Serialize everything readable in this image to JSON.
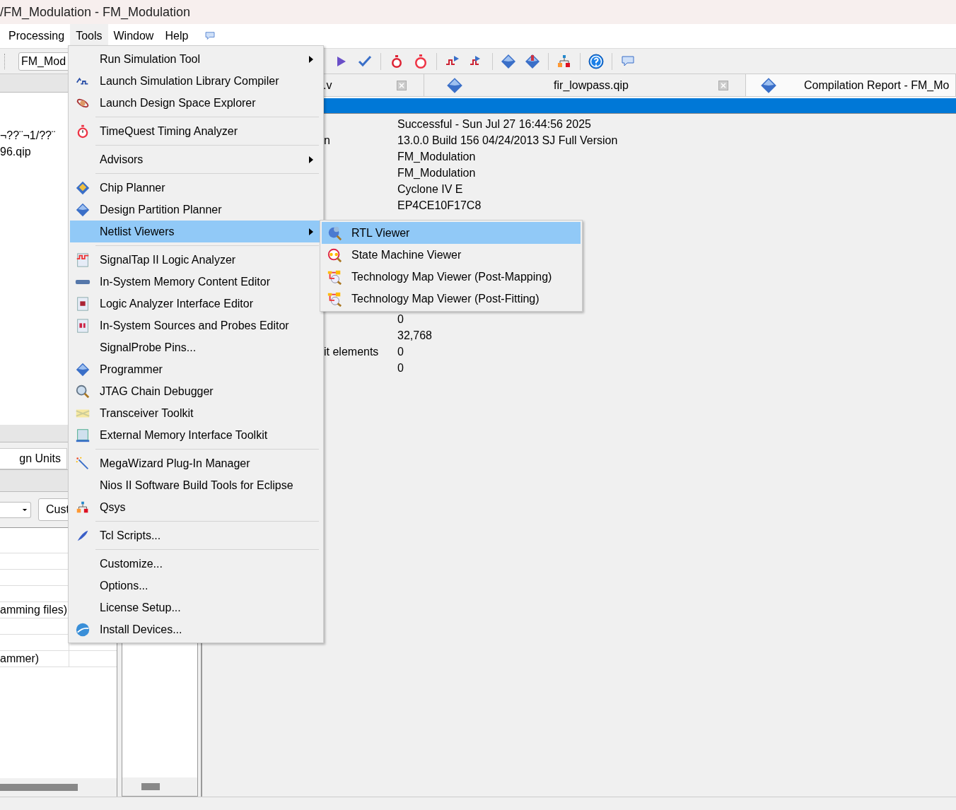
{
  "window": {
    "title": "/FM_Modulation - FM_Modulation"
  },
  "menu_bar": [
    {
      "label": "Processing",
      "selected": false
    },
    {
      "label": "Tools",
      "selected": true
    },
    {
      "label": "Window",
      "selected": false
    },
    {
      "label": "Help",
      "selected": false
    }
  ],
  "toolbar": {
    "project_combo": "FM_Mod"
  },
  "project_navigator": {
    "lines": [
      "¬??¨¬1/??¨",
      "96.qip"
    ]
  },
  "tasks": {
    "tab": "gn Units",
    "button": "Cust",
    "rows": [
      {},
      {},
      {},
      {},
      {
        "label": "amming files)"
      },
      {},
      {},
      {
        "label": "ammer)"
      }
    ]
  },
  "editor_tabs": [
    {
      "label": ".v",
      "selected": false
    },
    {
      "label": "fir_lowpass.qip",
      "selected": false
    },
    {
      "label": "Compilation Report - FM_Mo",
      "selected": true
    }
  ],
  "report": {
    "rows_top": [
      {
        "value": "Successful - Sun Jul 27 16:44:56 2025"
      },
      {
        "label": "n",
        "value": "13.0.0 Build 156 04/24/2013 SJ Full Version"
      },
      {
        "value": "FM_Modulation"
      },
      {
        "value": "FM_Modulation"
      },
      {
        "value": "Cyclone IV E"
      },
      {
        "value": "EP4CE10F17C8"
      }
    ],
    "rows_bottom": [
      {
        "value": "0"
      },
      {
        "value": "32,768"
      },
      {
        "label": "it elements",
        "value": "0"
      },
      {
        "value": "0"
      }
    ]
  },
  "tools_menu": [
    {
      "kind": "item",
      "label": "Run Simulation Tool",
      "submenu": true,
      "selected": false
    },
    {
      "kind": "item",
      "label": "Launch Simulation Library Compiler",
      "submenu": false,
      "selected": false
    },
    {
      "kind": "item",
      "label": "Launch Design Space Explorer",
      "submenu": false,
      "selected": false
    },
    {
      "kind": "separator"
    },
    {
      "kind": "item",
      "label": "TimeQuest Timing Analyzer",
      "submenu": false,
      "selected": false
    },
    {
      "kind": "separator"
    },
    {
      "kind": "item",
      "label": "Advisors",
      "submenu": true,
      "selected": false
    },
    {
      "kind": "separator"
    },
    {
      "kind": "item",
      "label": "Chip Planner",
      "submenu": false,
      "selected": false
    },
    {
      "kind": "item",
      "label": "Design Partition Planner",
      "submenu": false,
      "selected": false
    },
    {
      "kind": "item",
      "label": "Netlist Viewers",
      "submenu": true,
      "selected": true
    },
    {
      "kind": "separator"
    },
    {
      "kind": "item",
      "label": "SignalTap II Logic Analyzer",
      "submenu": false,
      "selected": false
    },
    {
      "kind": "item",
      "label": "In-System Memory Content Editor",
      "submenu": false,
      "selected": false
    },
    {
      "kind": "item",
      "label": "Logic Analyzer Interface Editor",
      "submenu": false,
      "selected": false
    },
    {
      "kind": "item",
      "label": "In-System Sources and Probes Editor",
      "submenu": false,
      "selected": false
    },
    {
      "kind": "item",
      "label": "SignalProbe Pins...",
      "submenu": false,
      "selected": false
    },
    {
      "kind": "item",
      "label": "Programmer",
      "submenu": false,
      "selected": false
    },
    {
      "kind": "item",
      "label": "JTAG Chain Debugger",
      "submenu": false,
      "selected": false
    },
    {
      "kind": "item",
      "label": "Transceiver Toolkit",
      "submenu": false,
      "selected": false
    },
    {
      "kind": "item",
      "label": "External Memory Interface Toolkit",
      "submenu": false,
      "selected": false
    },
    {
      "kind": "separator"
    },
    {
      "kind": "item",
      "label": "MegaWizard Plug-In Manager",
      "submenu": false,
      "selected": false
    },
    {
      "kind": "item",
      "label": "Nios II Software Build Tools for Eclipse",
      "submenu": false,
      "selected": false
    },
    {
      "kind": "item",
      "label": "Qsys",
      "submenu": false,
      "selected": false
    },
    {
      "kind": "separator"
    },
    {
      "kind": "item",
      "label": "Tcl Scripts...",
      "submenu": false,
      "selected": false
    },
    {
      "kind": "separator"
    },
    {
      "kind": "item",
      "label": "Customize...",
      "submenu": false,
      "selected": false
    },
    {
      "kind": "item",
      "label": "Options...",
      "submenu": false,
      "selected": false
    },
    {
      "kind": "item",
      "label": "License Setup...",
      "submenu": false,
      "selected": false
    },
    {
      "kind": "item",
      "label": "Install Devices...",
      "submenu": false,
      "selected": false
    }
  ],
  "netlist_submenu": [
    {
      "label": "RTL Viewer",
      "selected": true
    },
    {
      "label": "State Machine Viewer",
      "selected": false
    },
    {
      "label": "Technology Map Viewer (Post-Mapping)",
      "selected": false
    },
    {
      "label": "Technology Map Viewer (Post-Fitting)",
      "selected": false
    }
  ]
}
